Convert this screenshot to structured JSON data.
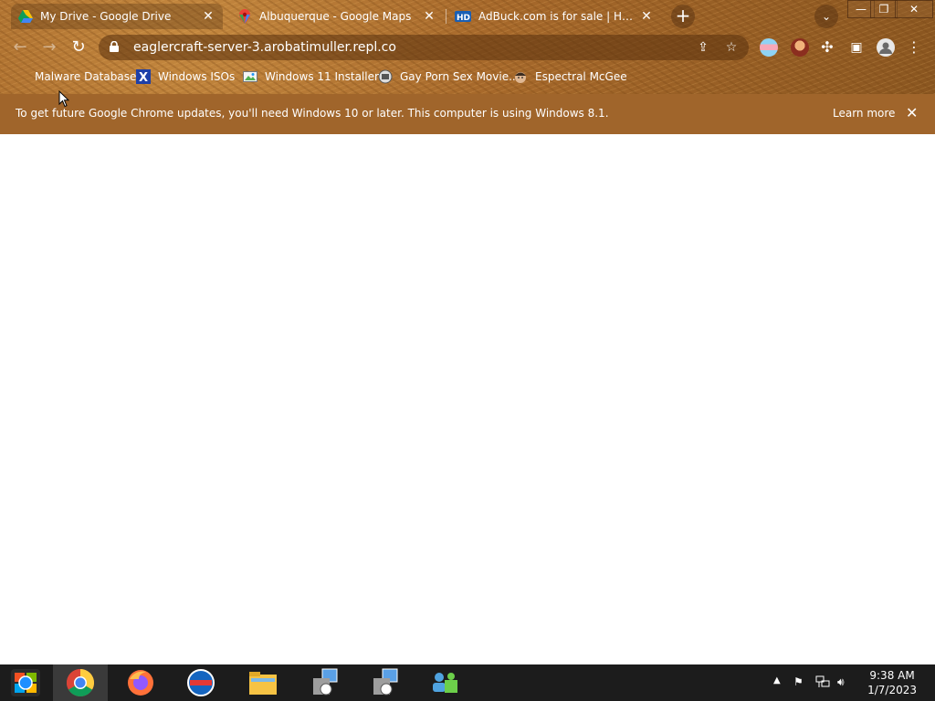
{
  "tabs": [
    {
      "title": "My Drive - Google Drive",
      "icon": "google-drive-icon",
      "active": true
    },
    {
      "title": "Albuquerque - Google Maps",
      "icon": "google-maps-icon",
      "active": false
    },
    {
      "title": "AdBuck.com is for sale | HugeDom",
      "icon": "hugedomains-icon",
      "active": false
    }
  ],
  "toolbar": {
    "url": "eaglercraft-server-3.arobatimuller.repl.co"
  },
  "bookmarks": [
    {
      "label": "Malware Database",
      "icon": "bookmark-blank-icon"
    },
    {
      "label": "Windows ISOs",
      "icon": "x-logo-icon"
    },
    {
      "label": "Windows 11 Installer",
      "icon": "image-icon"
    },
    {
      "label": "Gay Porn Sex Movie...",
      "icon": "site-icon"
    },
    {
      "label": "Espectral McGee",
      "icon": "face-icon"
    }
  ],
  "infobar": {
    "message": "To get future Google Chrome updates, you'll need Windows 10 or later. This computer is using Windows 8.1.",
    "learn_more": "Learn more"
  },
  "clock": {
    "time": "9:38 AM",
    "date": "1/7/2023"
  },
  "colors": {
    "infobar": "#a0652b",
    "taskbar": "#1c1c1c"
  }
}
